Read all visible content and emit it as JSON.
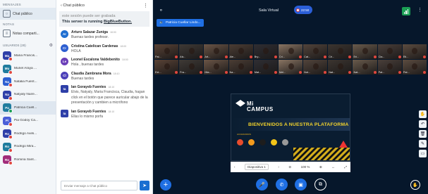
{
  "sidebar": {
    "messages_heading": "MENSAJES",
    "public_chat": "Chat público",
    "notes_heading": "NOTAS",
    "shared_notes": "Notas comparti...",
    "users_heading": "USUARIOS (28)",
    "users": [
      {
        "initials": "Ma",
        "name": "Maria Francis...",
        "color": "#2e3fa8"
      },
      {
        "initials": "Mu",
        "name": "Muriel Araya ...",
        "color": "#1f7c9e"
      },
      {
        "initials": "Na",
        "name": "Natalia Fuent...",
        "color": "#2d5fd1"
      },
      {
        "initials": "Na",
        "name": "Natyaly Nuire...",
        "color": "#2e3fa8"
      },
      {
        "initials": "Pa",
        "name": "Patricia Cuell...",
        "color": "#1f7c9e"
      },
      {
        "initials": "Pi",
        "name": "Pia Godoy Ca...",
        "color": "#4b5fd8"
      },
      {
        "initials": "Ro",
        "name": "Rodrigo Aveli...",
        "color": "#2e3fa8"
      },
      {
        "initials": "Ro",
        "name": "Rodrigo Mira...",
        "color": "#1f7c9e"
      },
      {
        "initials": "Ro",
        "name": "Romina Sant...",
        "color": "#a12c7a"
      }
    ]
  },
  "chat": {
    "back_label": "Chat público",
    "system_line1": "este sesión puede ser grabada",
    "system_line2_prefix": "This server is running ",
    "system_line2_link": "BigBlueButton.",
    "messages": [
      {
        "initials": "Ar",
        "name": "Arturo Salazar Zuniga",
        "time": "18:00",
        "text": "Buenas tardes profesor.",
        "color": "#1f6fd1",
        "shape": "round"
      },
      {
        "initials": "Cr",
        "name": "Cristina Catelican Cardenas",
        "time": "18:00",
        "text": "HOLA",
        "color": "#2d5fd1",
        "shape": "round"
      },
      {
        "initials": "Le",
        "name": "Leonel Escalona Valdebenito",
        "time": "18:00",
        "text": "Hola , buenas tardes",
        "color": "#6b3fb8",
        "shape": "round"
      },
      {
        "initials": "Cl",
        "name": "Claudia Zambrana Mora",
        "time": "18:10",
        "text": "Buenas tardes",
        "color": "#4b3fb8",
        "shape": "round"
      },
      {
        "initials": "Ia",
        "name": "Ian Gorayeb Fuentes",
        "time": "18:10",
        "text": "Elvis, Natyaly, Maria Francisca, Claudia, hagan click en el botón que parece auricular abajo de la presentación y cambien a micrófono",
        "color": "#2e3fa8",
        "shape": "square"
      },
      {
        "initials": "Ia",
        "name": "Ian Gorayeb Fuentes",
        "time": "18:10",
        "text": "Ellas lo mismo porfa",
        "color": "#2e3fa8",
        "shape": "square"
      }
    ],
    "input_placeholder": "Enviar mensaje a Chat público"
  },
  "topbar": {
    "title": "Sala Virtual",
    "timer": "22:50",
    "talking": "Patricia Cuellar Lindo..."
  },
  "tiles": [
    "Pal...",
    "Alv...",
    "Art...",
    "Ale...",
    "Bry...",
    "Cri...",
    "Cat...",
    "Cri...",
    "Eri...",
    "Cla...",
    "Eti...",
    "Ext...",
    "Fra...",
    "Mia...",
    "Na...",
    "Mat...",
    "Mel...",
    "Not...",
    "Nat...",
    "Nat...",
    "Pat...",
    "Pat..."
  ],
  "slide": {
    "logo_mi": "Mi",
    "logo_campus": "CAMPUS",
    "welcome": "BIENVENIDOS A NUESTRA PLATAFORMA",
    "accessories": "ACCESORIOS",
    "page_select": "Diapositiva 1",
    "zoom": "100 %"
  },
  "colors": {
    "brand_blue": "#1f6fe3",
    "main_bg": "#06172b",
    "welcome_yellow": "#f3d32c"
  }
}
